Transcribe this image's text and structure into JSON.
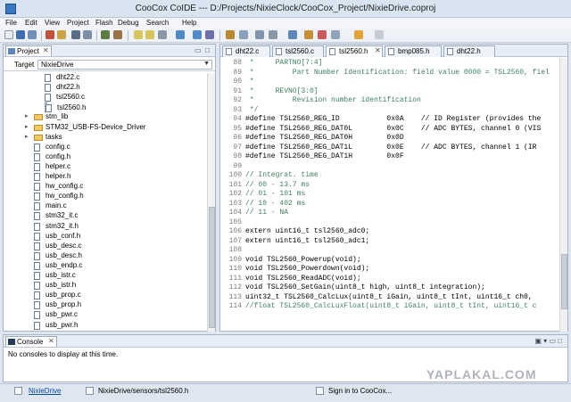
{
  "window": {
    "title": "CooCox CoIDE --- D:/Projects/NixieClock/CooCox_Project/NixieDrive.coproj"
  },
  "menu": [
    "File",
    "Edit",
    "View",
    "Project",
    "Flash",
    "Debug",
    "Search",
    "Help"
  ],
  "project_panel": {
    "tab_label": "Project",
    "target_label": "Target",
    "target_value": "NixieDrive",
    "tree": [
      {
        "label": "dht22.c",
        "type": "file",
        "level": 2
      },
      {
        "label": "dht22.h",
        "type": "file",
        "level": 2
      },
      {
        "label": "tsl2560.c",
        "type": "file",
        "level": 2
      },
      {
        "label": "tsl2560.h",
        "type": "file",
        "level": 2,
        "selected": true
      },
      {
        "label": "stm_lib",
        "type": "folder",
        "level": 1
      },
      {
        "label": "STM32_USB-FS-Device_Driver",
        "type": "folder",
        "level": 1
      },
      {
        "label": "tasks",
        "type": "folder",
        "level": 1
      },
      {
        "label": "config.c",
        "type": "file",
        "level": 1
      },
      {
        "label": "config.h",
        "type": "file",
        "level": 1
      },
      {
        "label": "helper.c",
        "type": "file",
        "level": 1
      },
      {
        "label": "helper.h",
        "type": "file",
        "level": 1
      },
      {
        "label": "hw_config.c",
        "type": "file",
        "level": 1
      },
      {
        "label": "hw_config.h",
        "type": "file",
        "level": 1
      },
      {
        "label": "main.c",
        "type": "file",
        "level": 1
      },
      {
        "label": "stm32_it.c",
        "type": "file",
        "level": 1
      },
      {
        "label": "stm32_it.h",
        "type": "file",
        "level": 1
      },
      {
        "label": "usb_conf.h",
        "type": "file",
        "level": 1
      },
      {
        "label": "usb_desc.c",
        "type": "file",
        "level": 1
      },
      {
        "label": "usb_desc.h",
        "type": "file",
        "level": 1
      },
      {
        "label": "usb_endp.c",
        "type": "file",
        "level": 1
      },
      {
        "label": "usb_istr.c",
        "type": "file",
        "level": 1
      },
      {
        "label": "usb_istr.h",
        "type": "file",
        "level": 1
      },
      {
        "label": "usb_prop.c",
        "type": "file",
        "level": 1
      },
      {
        "label": "usb_prop.h",
        "type": "file",
        "level": 1
      },
      {
        "label": "usb_pwr.c",
        "type": "file",
        "level": 1
      },
      {
        "label": "usb_pwr.h",
        "type": "file",
        "level": 1
      }
    ]
  },
  "editor": {
    "tabs": [
      {
        "label": "dht22.c",
        "active": false
      },
      {
        "label": "tsl2560.c",
        "active": false
      },
      {
        "label": "tsl2560.h",
        "active": true
      },
      {
        "label": "bmp085.h",
        "active": false
      },
      {
        "label": "dht22.h",
        "active": false
      }
    ],
    "lines": [
      {
        "n": "88",
        "t": " *     PARTNO[7:4]",
        "s": "comment"
      },
      {
        "n": "89",
        "t": " *         Part Number Identification: field value 0000 = TSL2560, fiel",
        "s": "comment"
      },
      {
        "n": "90",
        "t": " *",
        "s": "comment"
      },
      {
        "n": "91",
        "t": " *     REVNO[3:0]",
        "s": "comment"
      },
      {
        "n": "92",
        "t": " *         Revision number identification",
        "s": "comment"
      },
      {
        "n": "93",
        "t": " */",
        "s": "comment"
      },
      {
        "n": "94",
        "t": "#define TSL2560_REG_ID           0x0A    // ID Register (provides the",
        "s": "define"
      },
      {
        "n": "95",
        "t": "#define TSL2560_REG_DAT0L        0x0C    // ADC BYTES, channel 0 (VIS",
        "s": "define"
      },
      {
        "n": "96",
        "t": "#define TSL2560_REG_DAT0H        0x0D",
        "s": "define"
      },
      {
        "n": "97",
        "t": "#define TSL2560_REG_DAT1L        0x0E    // ADC BYTES, channel 1 (IR",
        "s": "define"
      },
      {
        "n": "98",
        "t": "#define TSL2560_REG_DAT1H        0x0F",
        "s": "define"
      },
      {
        "n": "99",
        "t": "",
        "s": "plain"
      },
      {
        "n": "100",
        "t": "// Integrat. time",
        "s": "comment"
      },
      {
        "n": "101",
        "t": "// 00 - 13.7 ms",
        "s": "comment"
      },
      {
        "n": "102",
        "t": "// 01 - 101 ms",
        "s": "comment"
      },
      {
        "n": "103",
        "t": "// 10 - 402 ms",
        "s": "comment"
      },
      {
        "n": "104",
        "t": "// 11 - NA",
        "s": "comment"
      },
      {
        "n": "105",
        "t": "",
        "s": "plain"
      },
      {
        "n": "106",
        "t": "extern uint16_t tsl2560_adc0;",
        "s": "define"
      },
      {
        "n": "107",
        "t": "extern uint16_t tsl2560_adc1;",
        "s": "define"
      },
      {
        "n": "108",
        "t": "",
        "s": "plain"
      },
      {
        "n": "109",
        "t": "void TSL2560_Powerup(void);",
        "s": "define"
      },
      {
        "n": "110",
        "t": "void TSL2560_Powerdown(void);",
        "s": "define"
      },
      {
        "n": "111",
        "t": "void TSL2560_ReadADC(void);",
        "s": "define"
      },
      {
        "n": "112",
        "t": "void TSL2560_SetGain(uint8_t high, uint8_t integration);",
        "s": "define"
      },
      {
        "n": "113",
        "t": "uint32_t TSL2560_CalcLux(uint8_t iGain, uint8_t tInt, uint16_t ch0, ",
        "s": "define"
      },
      {
        "n": "114",
        "t": "//float TSL2560_CalcLuxFloat(uint8_t iGain, uint8_t tInt, uint16_t c",
        "s": "comment"
      }
    ]
  },
  "console": {
    "tab_label": "Console",
    "message": "No consoles to display at this time."
  },
  "status": {
    "project_link": "NixieDrive",
    "path": "NixieDrive/sensors/tsl2560.h",
    "signin": "Sign in to CooCox..."
  },
  "watermark": "YAPLAKAL.COM"
}
